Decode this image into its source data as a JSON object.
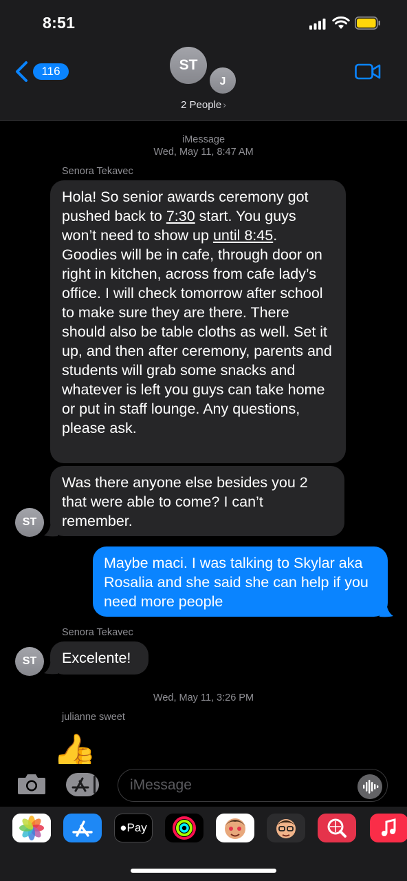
{
  "status_bar": {
    "time": "8:51"
  },
  "header": {
    "back_badge": "116",
    "avatar_1": "ST",
    "avatar_2": "J",
    "title": "2 People",
    "title_chevron": "›"
  },
  "messages": {
    "service_label": "iMessage",
    "timestamp_1": "Wed, May 11, 8:47 AM",
    "sender_1": "Senora Tekavec",
    "msg1_part_a": "Hola! So senior awards ceremony got pushed back to ",
    "msg1_link_a": "7:30",
    "msg1_part_b": " start. You guys won’t need to show up ",
    "msg1_link_b": "until 8:45",
    "msg1_part_c": ". Goodies will be in cafe, through door on right in kitchen, across from cafe lady’s office. I will check tomorrow after school to make sure they are there. There should also be table cloths as well. Set it up, and then after ceremony, parents and students will grab some snacks and whatever is left you guys can take home or put in staff lounge. Any questions, please ask.",
    "msg2": "Was there anyone else besides you 2 that were able to come? I can’t remember.",
    "avatar_msg": "ST",
    "msg3": "Maybe maci. I was talking to Skylar aka Rosalia and she said she can help if you need more people",
    "sender_2": "Senora Tekavec",
    "msg4": "Excelente!",
    "timestamp_2": "Wed, May 11, 3:26 PM",
    "sender_3": "julianne sweet",
    "thumb_emoji": "👍"
  },
  "input": {
    "placeholder": "iMessage"
  },
  "drawer": {
    "apps": [
      "photos-icon",
      "app-store-icon",
      "apple-pay-icon",
      "activity-icon",
      "memoji-stickers-icon",
      "memoji-icon",
      "web-images-icon",
      "music-icon"
    ],
    "pay_label": "Pay"
  },
  "colors": {
    "accent": "#0a84ff",
    "incoming_bubble": "#262628",
    "header_bg": "#1c1c1e"
  }
}
